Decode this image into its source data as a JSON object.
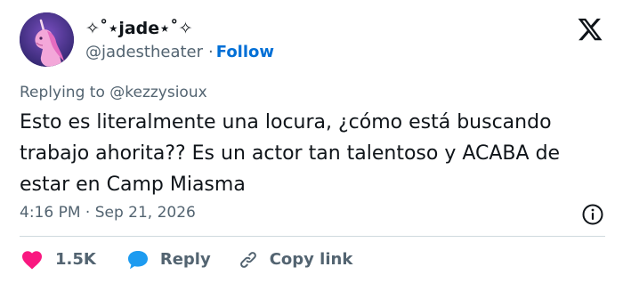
{
  "author": {
    "display_name": "✧˚⋆jade⋆˚✧",
    "handle": "@jadestheater",
    "separator": "·",
    "follow_label": "Follow"
  },
  "tweet": {
    "reply_prefix": "Replying to",
    "reply_to": "@kezzysioux",
    "text": "Esto es literalmente una locura, ¿cómo está buscando trabajo ahorita?? Es un actor tan talentoso y ACABA de estar en Camp Miasma",
    "timestamp": "4:16 PM · Sep 21, 2026"
  },
  "actions": {
    "likes": "1.5K",
    "reply_label": "Reply",
    "copy_link_label": "Copy link"
  },
  "colors": {
    "text_primary": "#0f1419",
    "text_secondary": "#536471",
    "follow_blue": "#006fd6",
    "like_pink": "#f91880",
    "reply_blue": "#1d9bf0",
    "divider": "#cfd9de"
  },
  "icons": {
    "brand": "x-logo-icon",
    "info": "info-icon",
    "like": "heart-icon",
    "reply": "speech-bubble-icon",
    "copy_link": "link-icon"
  }
}
